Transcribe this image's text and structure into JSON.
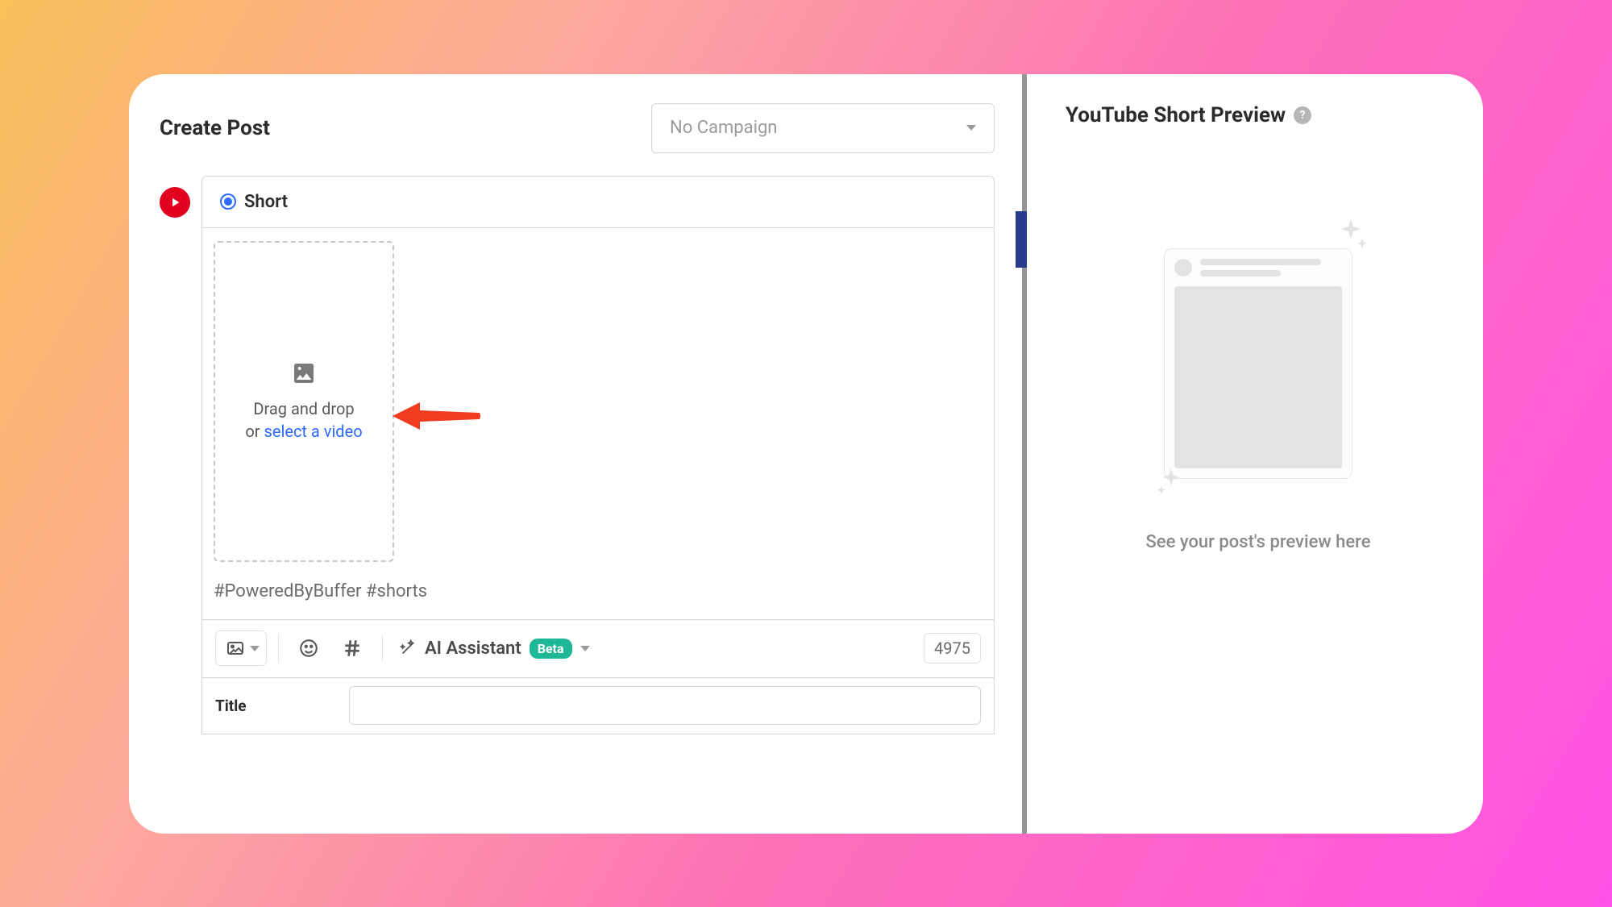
{
  "header": {
    "title": "Create Post",
    "campaign_placeholder": "No Campaign"
  },
  "composer": {
    "type_label": "Short",
    "dropzone_line1": "Drag and drop",
    "dropzone_line2_prefix": "or ",
    "dropzone_link": "select a video",
    "hashtags": "#PoweredByBuffer #shorts"
  },
  "toolbar": {
    "ai_label": "AI Assistant",
    "beta_label": "Beta",
    "char_count": "4975"
  },
  "title_section": {
    "label": "Title",
    "value": ""
  },
  "preview": {
    "heading": "YouTube Short Preview",
    "help_glyph": "?",
    "caption": "See your post's preview here"
  }
}
